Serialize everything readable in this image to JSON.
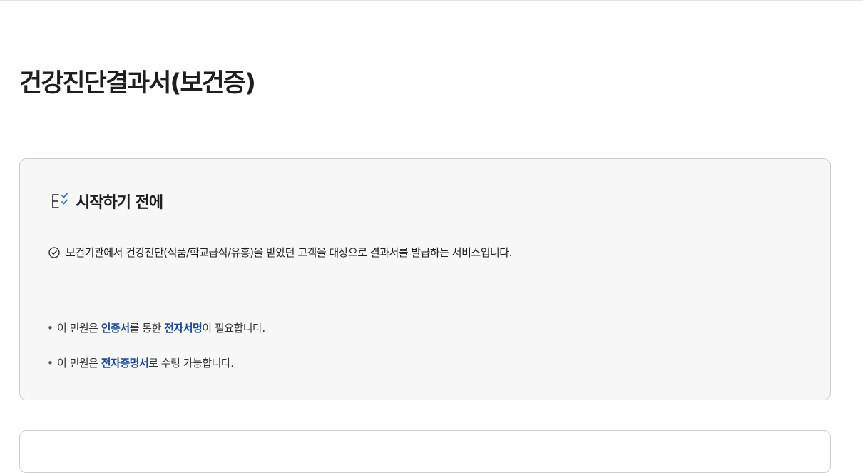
{
  "page": {
    "title": "건강진단결과서(보건증)"
  },
  "intro_card": {
    "heading": "시작하기 전에",
    "heading_icon": "checklist-icon",
    "service_description": "보건기관에서 건강진단(식품/학교급식/유흥)을 받았던 고객을 대상으로 결과서를 발급하는 서비스입니다.",
    "service_icon": "circle-check-icon",
    "notices": [
      {
        "parts": [
          "이 민원은 ",
          "인증서",
          "를 통한 ",
          "전자서명",
          "이 필요합니다."
        ]
      },
      {
        "parts": [
          "이 민원은 ",
          "전자증명서",
          "로 수령 가능합니다."
        ]
      }
    ],
    "bullet": "•",
    "highlight_color": "#1a4a9c"
  }
}
